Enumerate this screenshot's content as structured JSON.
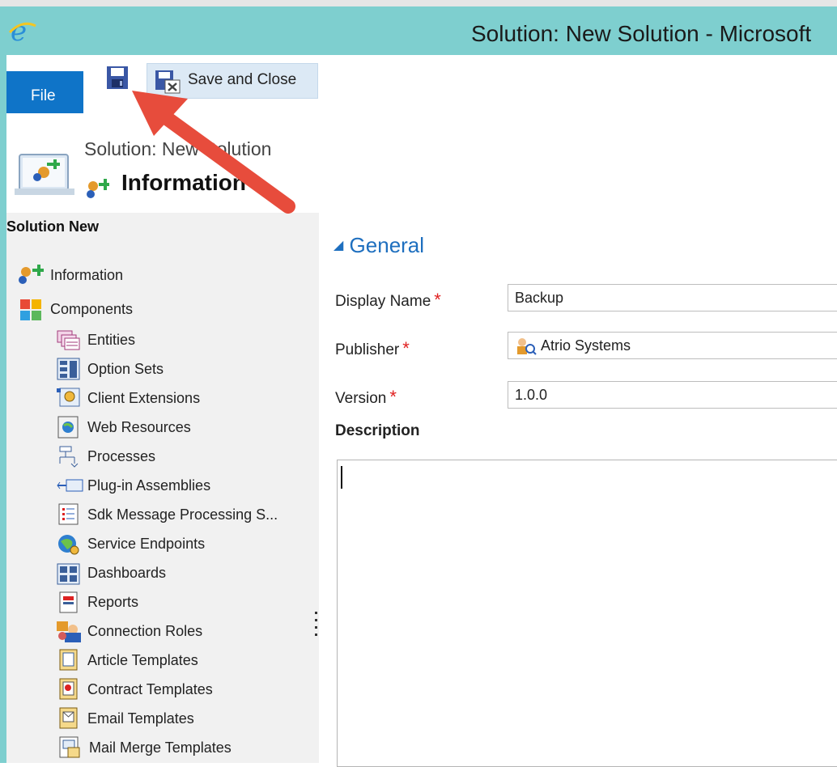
{
  "window": {
    "title": "Solution: New Solution - Microsoft"
  },
  "ribbon": {
    "file_tab": "File",
    "save_and_close": "Save and Close"
  },
  "header": {
    "breadcrumb": "Solution: New Solution",
    "page_title": "Information"
  },
  "sidebar": {
    "heading": "Solution New",
    "items": [
      {
        "label": "Information",
        "icon": "information-icon"
      },
      {
        "label": "Components",
        "icon": "components-icon"
      },
      {
        "label": "Entities",
        "icon": "entities-icon"
      },
      {
        "label": "Option Sets",
        "icon": "option-sets-icon"
      },
      {
        "label": "Client Extensions",
        "icon": "client-extensions-icon"
      },
      {
        "label": "Web Resources",
        "icon": "web-resources-icon"
      },
      {
        "label": "Processes",
        "icon": "processes-icon"
      },
      {
        "label": "Plug-in Assemblies",
        "icon": "plugin-assemblies-icon"
      },
      {
        "label": "Sdk Message Processing S...",
        "icon": "sdk-message-icon"
      },
      {
        "label": "Service Endpoints",
        "icon": "service-endpoints-icon"
      },
      {
        "label": "Dashboards",
        "icon": "dashboards-icon"
      },
      {
        "label": "Reports",
        "icon": "reports-icon"
      },
      {
        "label": "Connection Roles",
        "icon": "connection-roles-icon"
      },
      {
        "label": "Article Templates",
        "icon": "article-templates-icon"
      },
      {
        "label": "Contract Templates",
        "icon": "contract-templates-icon"
      },
      {
        "label": "Email Templates",
        "icon": "email-templates-icon"
      },
      {
        "label": "Mail Merge Templates",
        "icon": "mail-merge-templates-icon"
      }
    ]
  },
  "form": {
    "section_title": "General",
    "display_name_label": "Display Name",
    "display_name_value": "Backup",
    "publisher_label": "Publisher",
    "publisher_value": "Atrio Systems",
    "version_label": "Version",
    "version_value": "1.0.0",
    "required_marker": "*",
    "description_label": "Description",
    "description_value": ""
  },
  "colors": {
    "titlebar": "#7ecfcf",
    "file_tab": "#0f74c8",
    "section": "#1e6fbf",
    "required": "#e02020",
    "annotation_arrow": "#e74c3c"
  }
}
